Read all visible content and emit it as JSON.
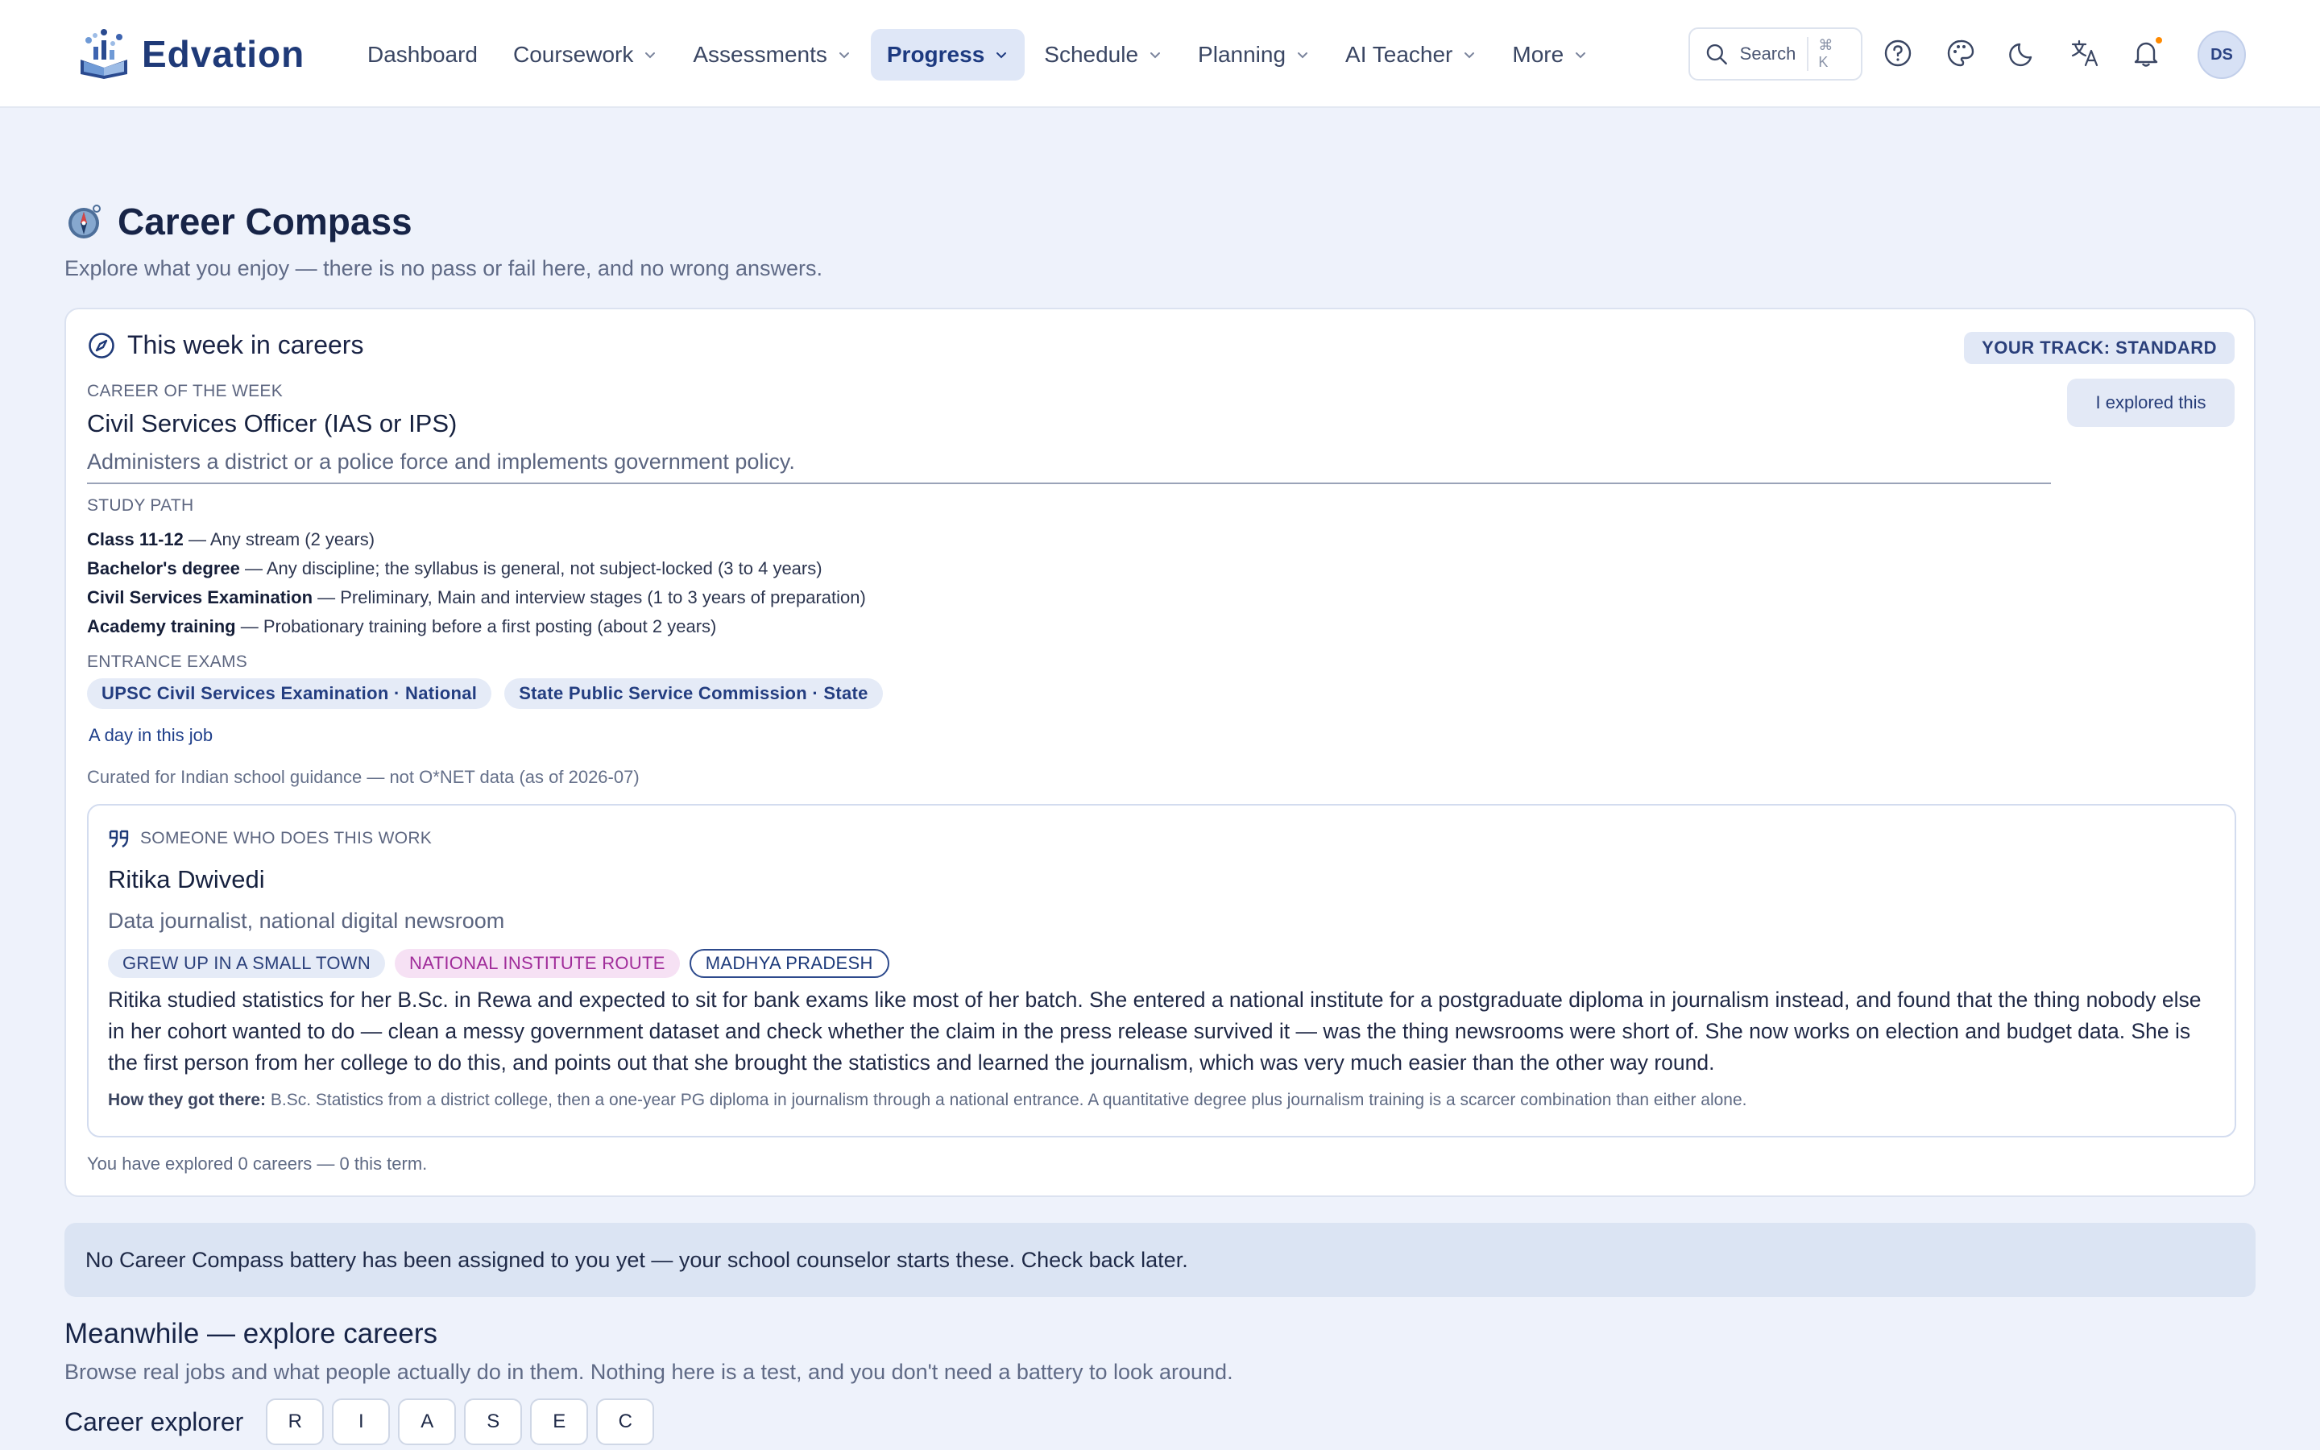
{
  "brand": {
    "name": "Edvation",
    "color": "#1f3a78"
  },
  "nav": [
    {
      "label": "Dashboard",
      "dropdown": false,
      "active": false
    },
    {
      "label": "Coursework",
      "dropdown": true,
      "active": false
    },
    {
      "label": "Assessments",
      "dropdown": true,
      "active": false
    },
    {
      "label": "Progress",
      "dropdown": true,
      "active": true
    },
    {
      "label": "Schedule",
      "dropdown": true,
      "active": false
    },
    {
      "label": "Planning",
      "dropdown": true,
      "active": false
    },
    {
      "label": "AI Teacher",
      "dropdown": true,
      "active": false
    },
    {
      "label": "More",
      "dropdown": true,
      "active": false
    }
  ],
  "search": {
    "label": "Search",
    "shortcut": "⌘ K"
  },
  "top_icons": [
    "help-icon",
    "palette-icon",
    "moon-icon",
    "translate-icon",
    "bell-icon"
  ],
  "user": {
    "initials": "DS"
  },
  "page": {
    "title": "Career Compass",
    "subtitle": "Explore what you enjoy — there is no pass or fail here, and no wrong answers."
  },
  "week": {
    "title": "This week in careers",
    "track": "YOUR TRACK: STANDARD",
    "explored_button": "I explored this",
    "career_label": "CAREER OF THE WEEK",
    "career_name": "Civil Services Officer (IAS or IPS)",
    "career_desc": "Administers a district or a police force and implements government policy.",
    "study_path_label": "STUDY PATH",
    "study_path": [
      {
        "step": "Class 11-12",
        "detail": " — Any stream (2 years)"
      },
      {
        "step": "Bachelor's degree",
        "detail": " — Any discipline; the syllabus is general, not subject-locked (3 to 4 years)"
      },
      {
        "step": "Civil Services Examination",
        "detail": " — Preliminary, Main and interview stages (1 to 3 years of preparation)"
      },
      {
        "step": "Academy training",
        "detail": " — Probationary training before a first posting (about 2 years)"
      }
    ],
    "exams_label": "ENTRANCE EXAMS",
    "exams": [
      "UPSC Civil Services Examination · National",
      "State Public Service Commission · State"
    ],
    "day_link": "A day in this job",
    "curated_note": "Curated for Indian school guidance — not O*NET data (as of 2026-07)",
    "person": {
      "label": "SOMEONE WHO DOES THIS WORK",
      "name": "Ritika Dwivedi",
      "role": "Data journalist, national digital newsroom",
      "tags": [
        "GREW UP IN A SMALL TOWN",
        "NATIONAL INSTITUTE ROUTE",
        "MADHYA PRADESH"
      ],
      "story": "Ritika studied statistics for her B.Sc. in Rewa and expected to sit for bank exams like most of her batch. She entered a national institute for a postgraduate diploma in journalism instead, and found that the thing nobody else in her cohort wanted to do — clean a messy government dataset and check whether the claim in the press release survived it — was the thing newsrooms were short of. She now works on election and budget data. She is the first person from her college to do this, and points out that she brought the statistics and learned the journalism, which was very much easier than the other way round.",
      "how_label": "How they got there:",
      "how_text": " B.Sc. Statistics from a district college, then a one-year PG diploma in journalism through a national entrance. A quantitative degree plus journalism training is a scarcer combination than either alone."
    },
    "explored_count": "You have explored 0 careers — 0 this term."
  },
  "notice": "No Career Compass battery has been assigned to you yet — your school counselor starts these. Check back later.",
  "explore": {
    "title": "Meanwhile — explore careers",
    "subtitle": "Browse real jobs and what people actually do in them. Nothing here is a test, and you don't need a battery to look around.",
    "explorer_label": "Career explorer",
    "riasec": [
      "R",
      "I",
      "A",
      "S",
      "E",
      "C"
    ]
  }
}
